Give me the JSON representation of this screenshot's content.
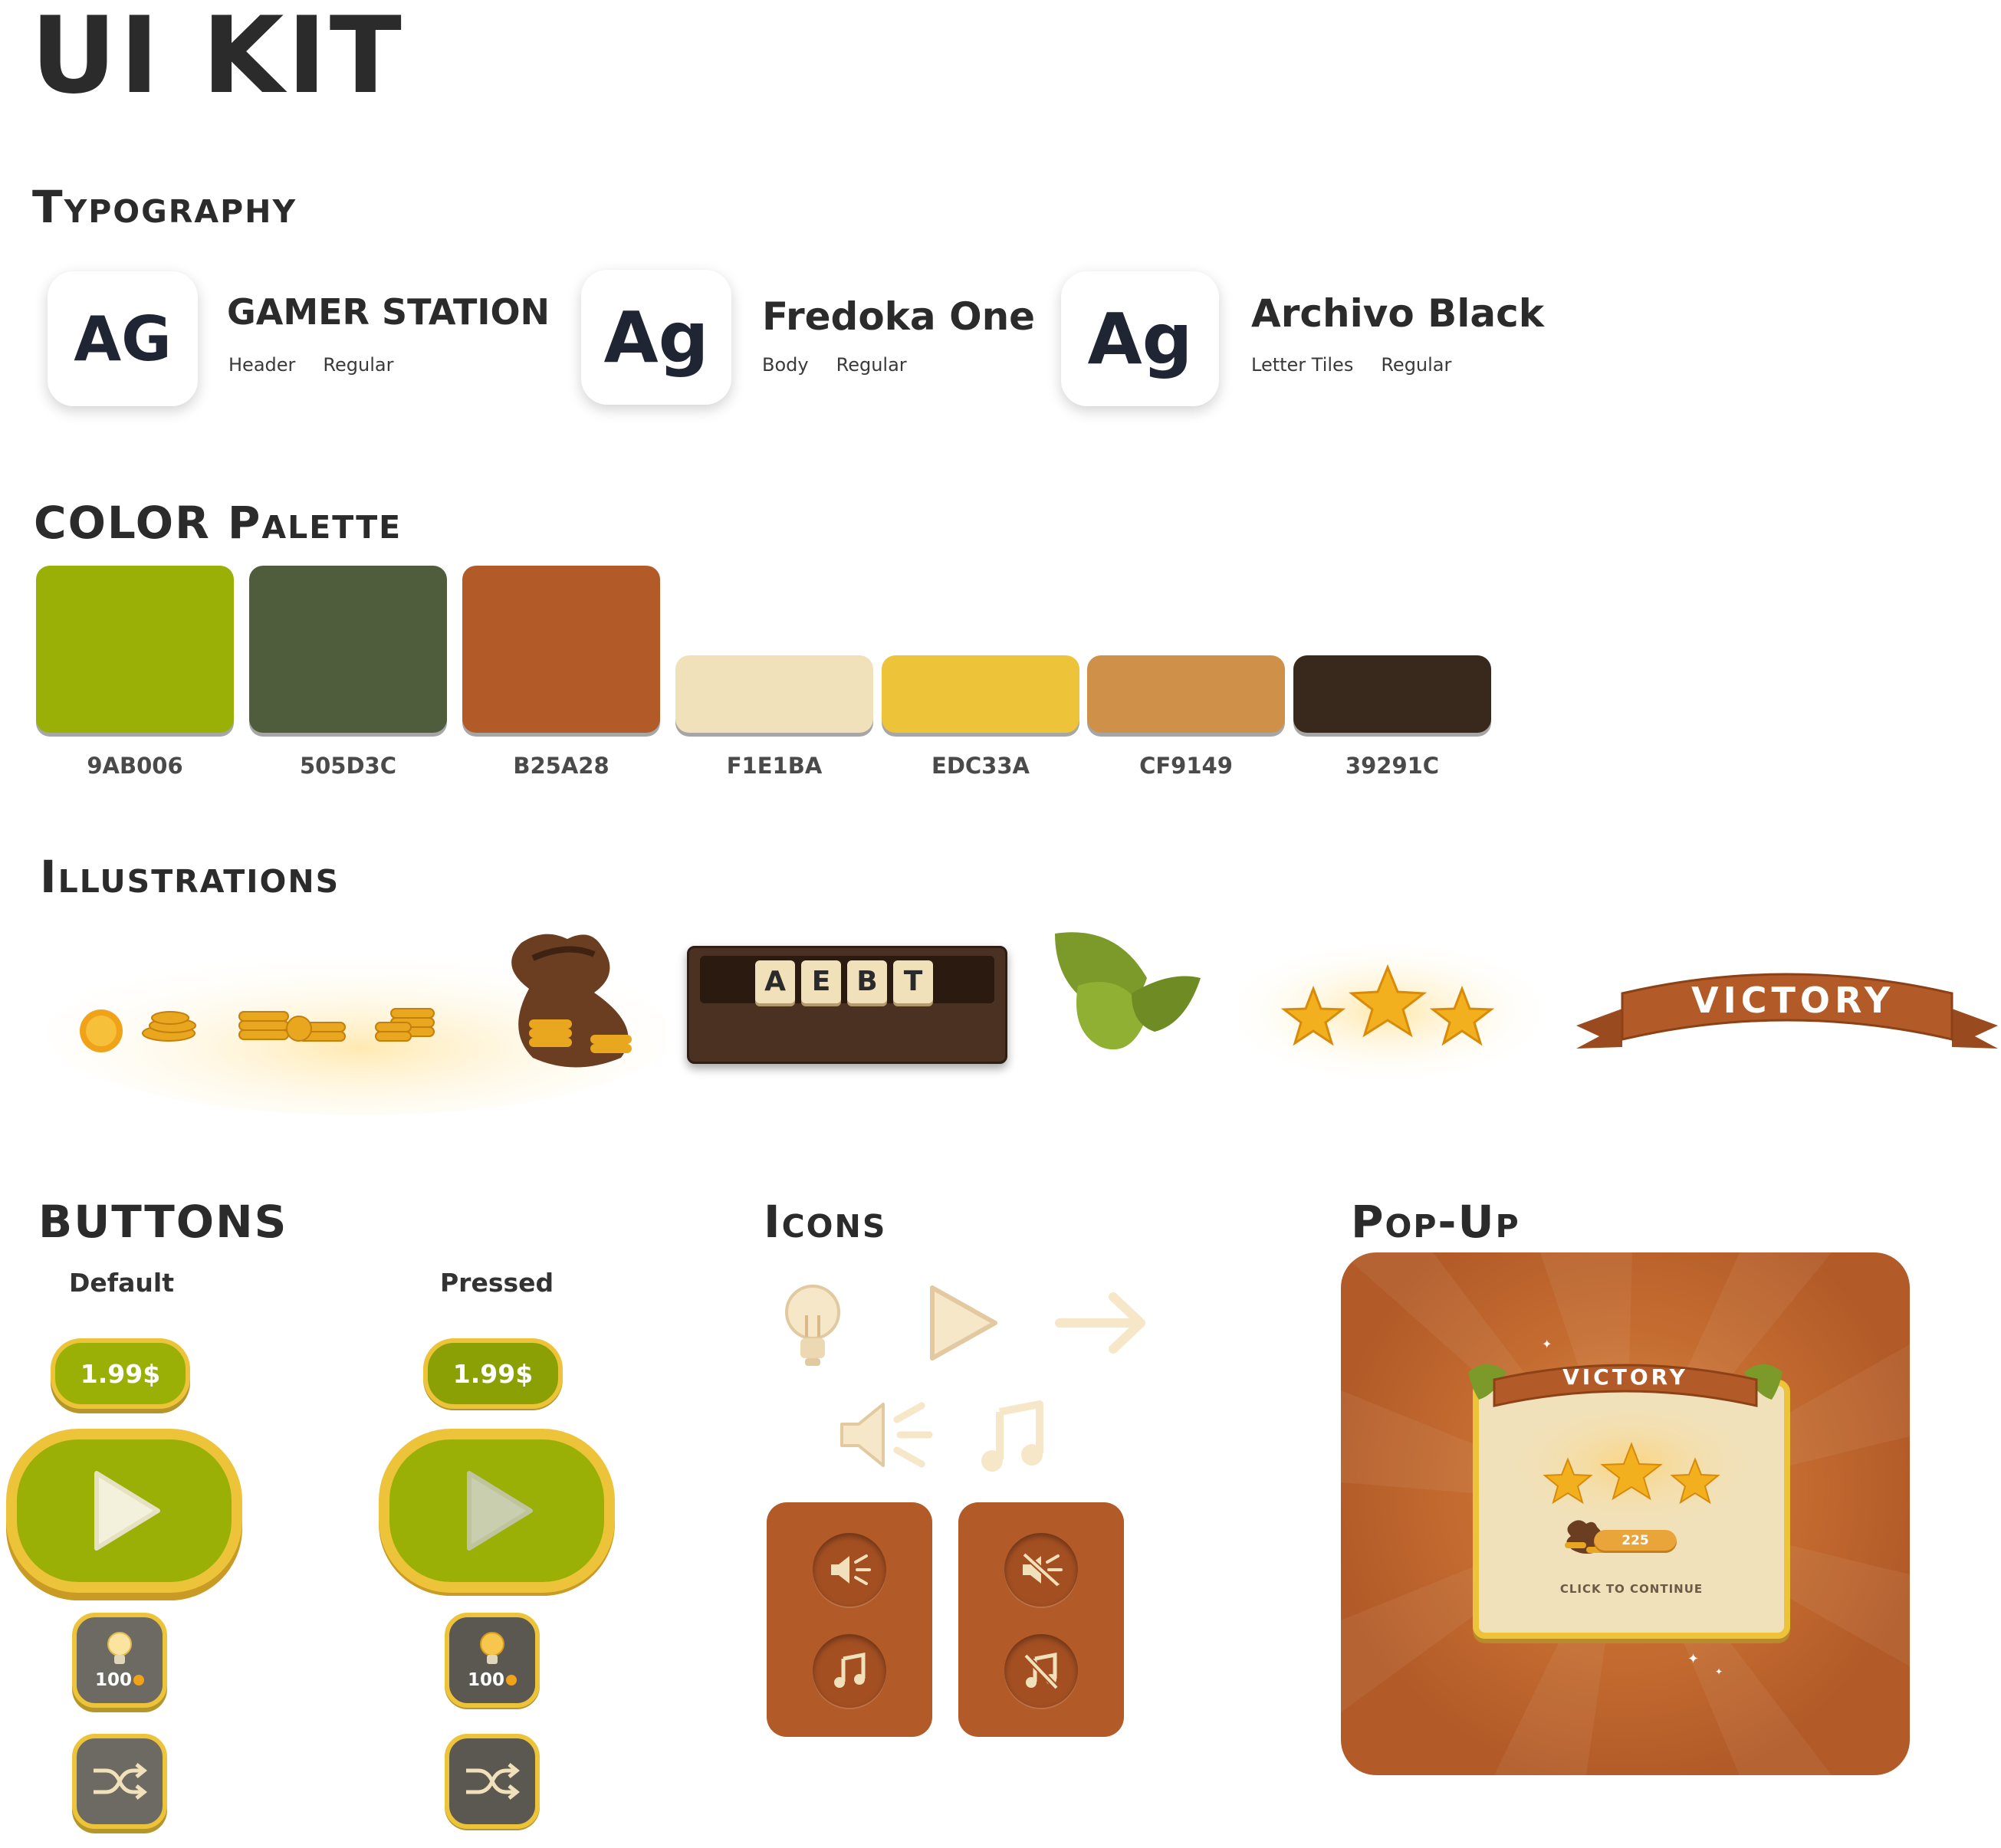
{
  "page": {
    "title": "UI KIT"
  },
  "typography": {
    "heading": "Typography",
    "fonts": [
      {
        "sample": "AG",
        "name": "GAMER STATION",
        "role": "Header",
        "weight": "Regular"
      },
      {
        "sample": "Ag",
        "name": "Fredoka One",
        "role": "Body",
        "weight": "Regular"
      },
      {
        "sample": "Ag",
        "name": "Archivo Black",
        "role": "Letter Tiles",
        "weight": "Regular"
      }
    ]
  },
  "palette": {
    "heading": "COLOR Palette",
    "colors": [
      {
        "hex": "9AB006",
        "color": "#9ab006"
      },
      {
        "hex": "505D3C",
        "color": "#505d3c"
      },
      {
        "hex": "B25A28",
        "color": "#b25a28"
      },
      {
        "hex": "F1E1BA",
        "color": "#f1e1ba"
      },
      {
        "hex": "EDC33A",
        "color": "#edc33a"
      },
      {
        "hex": "CF9149",
        "color": "#cf9149"
      },
      {
        "hex": "39291C",
        "color": "#39291c"
      }
    ]
  },
  "illustrations": {
    "heading": "Illustrations",
    "letter_tiles": [
      "A",
      "E",
      "B",
      "T"
    ],
    "banner_text": "VICTORY"
  },
  "buttons": {
    "heading": "BUTTONS",
    "default_label": "Default",
    "pressed_label": "Pressed",
    "price": "1.99$",
    "hint_cost": "100"
  },
  "icons": {
    "heading": "Icons",
    "names": [
      "bulb-icon",
      "play-icon",
      "arrow-right-icon",
      "speaker-icon",
      "music-note-icon"
    ]
  },
  "popup": {
    "heading": "Pop-Up",
    "banner_text": "VICTORY",
    "coin_value": "225",
    "continue_text": "CLICK TO CONTINUE"
  }
}
